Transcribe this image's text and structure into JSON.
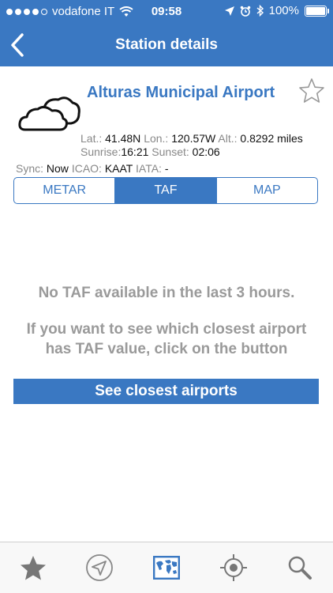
{
  "status_bar": {
    "carrier": "vodafone IT",
    "time": "09:58",
    "battery": "100%",
    "battery_level": 1.0,
    "signal_bars_filled": 4,
    "signal_bars_total": 5
  },
  "nav": {
    "title": "Station details",
    "back_icon": "chevron-left-icon"
  },
  "station": {
    "name": "Alturas Municipal Airport",
    "weather_icon": "cloud-icon",
    "favorite_icon": "star-outline-icon",
    "lat_label": "Lat.:",
    "lat": "41.48N",
    "lon_label": "Lon.:",
    "lon": "120.57W",
    "alt_label": "Alt.:",
    "alt": "0.8292 miles",
    "sunrise_label": "Sunrise:",
    "sunrise": "16:21",
    "sunset_label": "Sunset:",
    "sunset": "02:06",
    "sync_label": "Sync:",
    "sync": "Now",
    "icao_label": "ICAO:",
    "icao": "KAAT",
    "iata_label": "IATA:",
    "iata": "-"
  },
  "segments": {
    "items": [
      "METAR",
      "TAF",
      "MAP"
    ],
    "selected": "TAF"
  },
  "content": {
    "no_data_message": "No TAF available in the last 3 hours.",
    "hint_message": "If you want to see which closest airport has TAF value, click on the button",
    "button_label": "See closest airports"
  },
  "tab_bar": {
    "icons": [
      "star-icon",
      "navigation-arrow-icon",
      "world-map-icon",
      "crosshair-icon",
      "search-icon"
    ],
    "selected": "world-map-icon"
  },
  "colors": {
    "accent": "#3a78c2",
    "muted_text": "#9a9a9a",
    "label_text": "#888888"
  }
}
